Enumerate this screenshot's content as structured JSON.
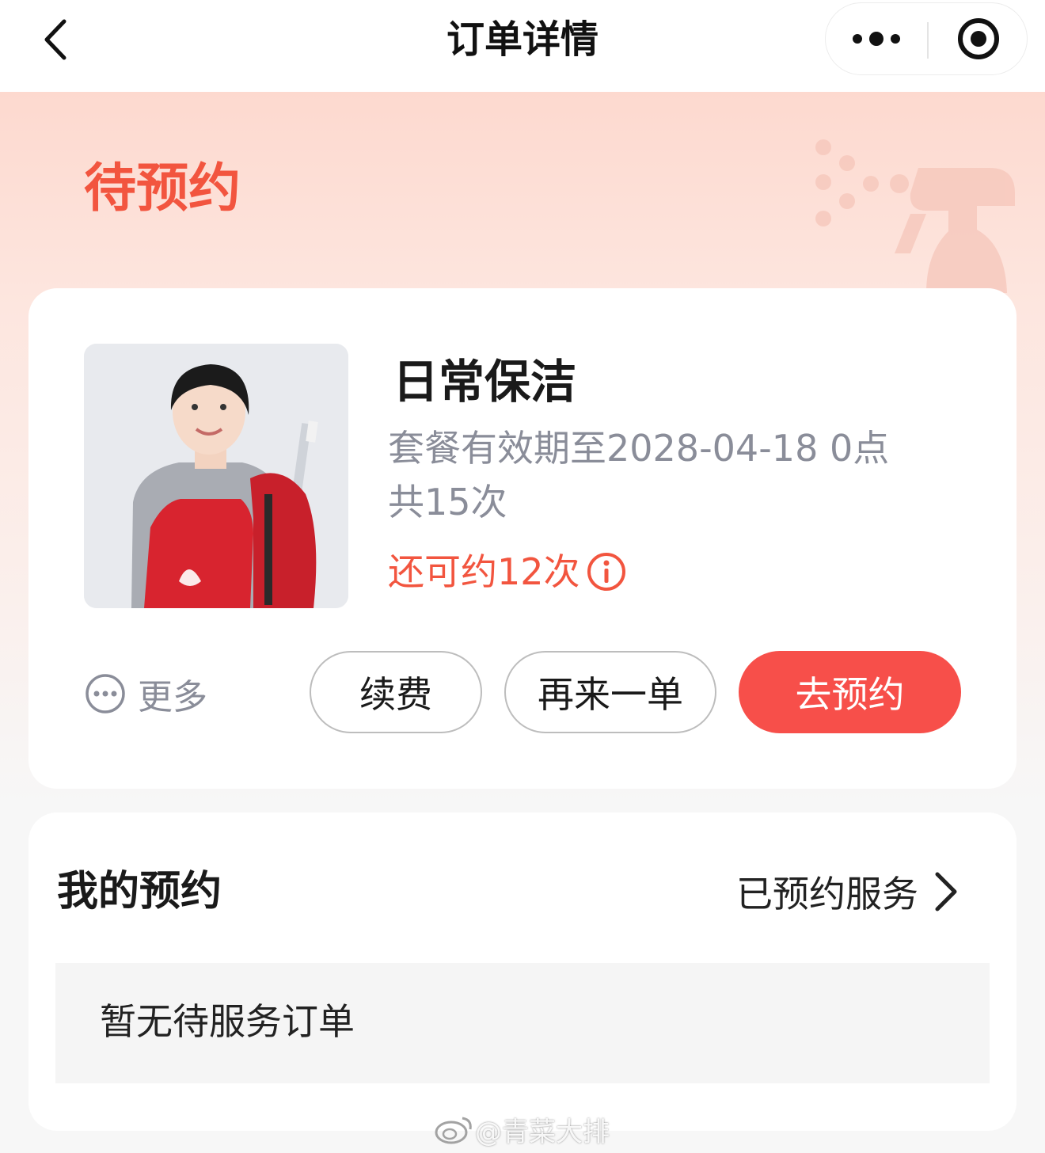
{
  "nav": {
    "title": "订单详情",
    "back_icon": "chevron-left-icon",
    "more_icon": "more-dots-icon",
    "close_icon": "target-circle-icon"
  },
  "status": {
    "label": "待预约",
    "color": "#f2553f"
  },
  "service_card": {
    "photo_icon": "cleaner-photo",
    "name": "日常保洁",
    "validity": "套餐有效期至2028-04-18 0点",
    "total": "共15次",
    "remaining": "还可约12次",
    "info_icon": "info-circle-icon",
    "more_label": "更多",
    "more_icon": "ellipsis-circle-icon",
    "buttons": {
      "renew": "续费",
      "reorder": "再来一单",
      "book": "去预约"
    },
    "primary_color": "#f74f4a"
  },
  "booking": {
    "title": "我的预约",
    "link_label": "已预约服务",
    "link_icon": "chevron-right-icon",
    "empty_text": "暂无待服务订单"
  },
  "watermark": {
    "text": "@青菜大排",
    "icon": "weibo-icon"
  }
}
